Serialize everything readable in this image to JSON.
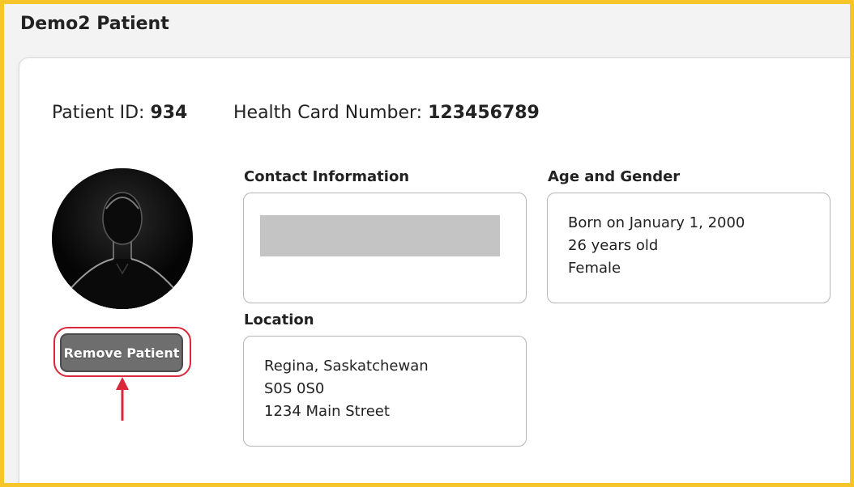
{
  "page_title": "Demo2 Patient",
  "patient_id": {
    "label": "Patient ID: ",
    "value": "934"
  },
  "health_card": {
    "label": "Health Card Number: ",
    "value": "123456789"
  },
  "remove_button_label": "Remove Patient",
  "contact": {
    "label": "Contact Information"
  },
  "age_gender": {
    "label": "Age and Gender",
    "lines": [
      "Born on January 1, 2000",
      "26 years old",
      "Female"
    ]
  },
  "location": {
    "label": "Location",
    "lines": [
      "Regina, Saskatchewan",
      "S0S 0S0",
      "1234 Main Street"
    ]
  },
  "colors": {
    "frame_border": "#f6c52a",
    "highlight": "#d8283a",
    "button_bg": "#6e6e6e"
  }
}
